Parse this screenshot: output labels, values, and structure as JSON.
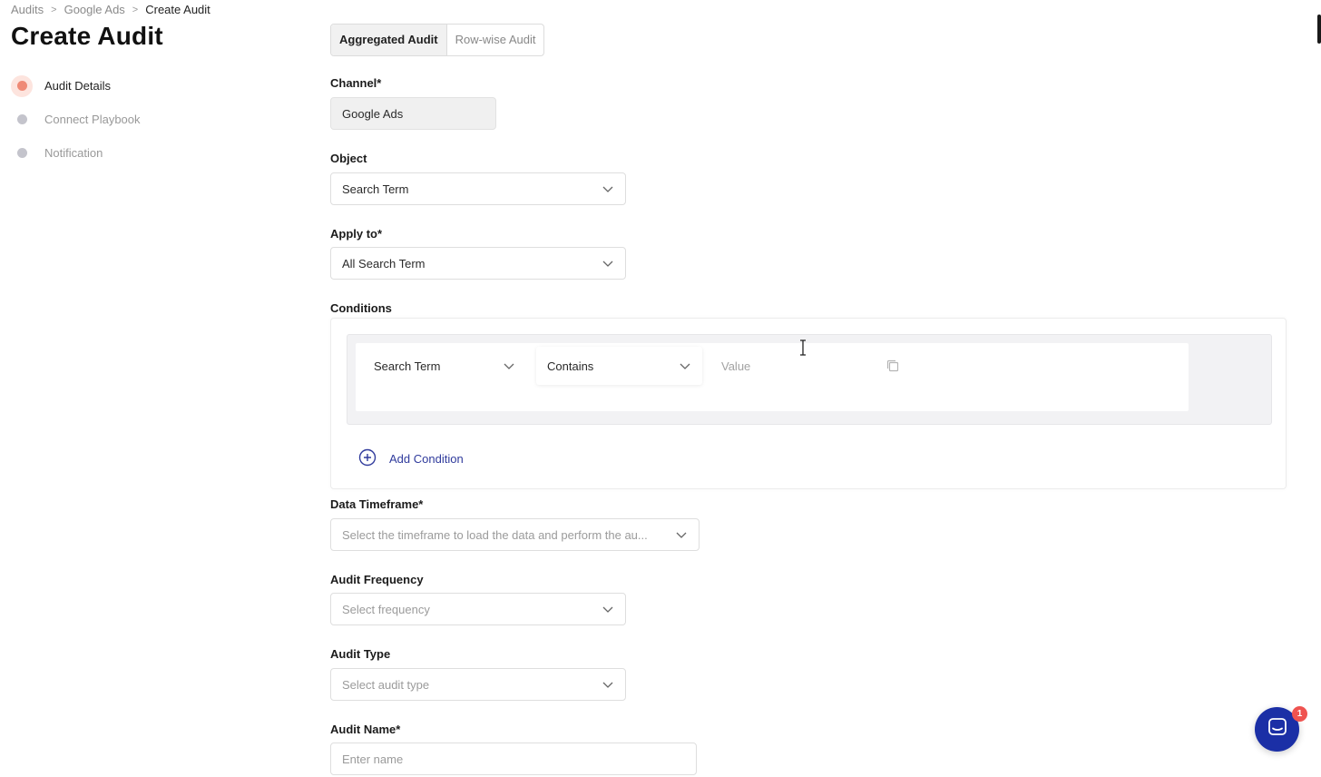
{
  "breadcrumb": {
    "items": [
      "Audits",
      "Google Ads"
    ],
    "current": "Create Audit",
    "separator": ">"
  },
  "page_title": "Create Audit",
  "steps": [
    {
      "label": "Audit Details",
      "state": "active"
    },
    {
      "label": "Connect Playbook",
      "state": "pending"
    },
    {
      "label": "Notification",
      "state": "pending"
    }
  ],
  "tabs": [
    {
      "label": "Aggregated Audit",
      "active": true
    },
    {
      "label": "Row-wise Audit",
      "active": false
    }
  ],
  "form": {
    "channel": {
      "label": "Channel*",
      "value": "Google Ads"
    },
    "object": {
      "label": "Object",
      "value": "Search Term"
    },
    "apply_to": {
      "label": "Apply to*",
      "value": "All Search Term"
    },
    "conditions": {
      "label": "Conditions",
      "rows": [
        {
          "field": "Search Term",
          "operator": "Contains",
          "value_placeholder": "Value"
        }
      ],
      "add_label": "Add Condition"
    },
    "data_timeframe": {
      "label": "Data Timeframe*",
      "placeholder": "Select the timeframe to load the data and perform the au..."
    },
    "audit_frequency": {
      "label": "Audit Frequency",
      "placeholder": "Select frequency"
    },
    "audit_type": {
      "label": "Audit Type",
      "placeholder": "Select audit type"
    },
    "audit_name": {
      "label": "Audit Name*",
      "placeholder": "Enter name"
    }
  },
  "chat": {
    "badge_count": "1"
  },
  "colors": {
    "accent": "#2f3a9c",
    "step_active": "#ef8a76",
    "chat_bg": "#1b2fa6",
    "badge": "#ef5350"
  }
}
